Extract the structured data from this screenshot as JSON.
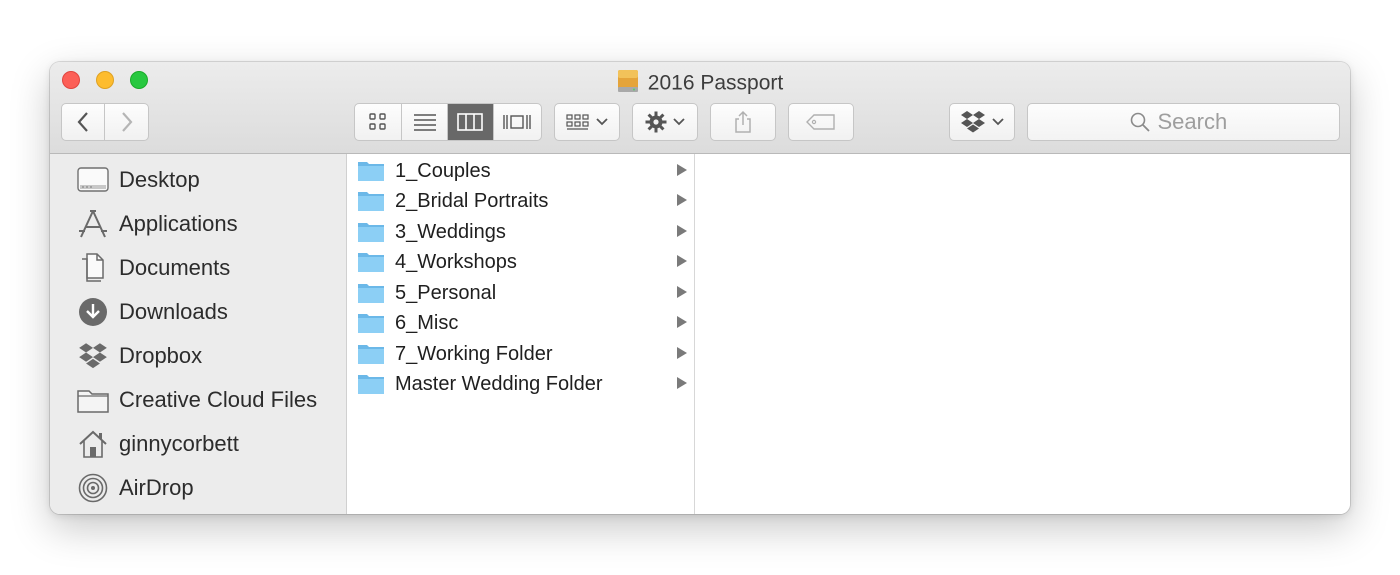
{
  "window": {
    "title": "2016 Passport"
  },
  "toolbar": {
    "back_icon": "chevron-left-icon",
    "forward_icon": "chevron-right-icon",
    "view_modes": [
      "icon-view-icon",
      "list-view-icon",
      "column-view-icon",
      "cover-flow-icon"
    ],
    "active_view": "column-view-icon",
    "arrange_icon": "arrange-icon",
    "action_icon": "gear-icon",
    "share_icon": "share-icon",
    "tag_icon": "tag-icon",
    "dropbox_icon": "dropbox-icon",
    "search": {
      "placeholder": "Search",
      "value": ""
    }
  },
  "sidebar": {
    "items": [
      {
        "label": "Desktop",
        "icon": "desktop-icon"
      },
      {
        "label": "Applications",
        "icon": "applications-icon"
      },
      {
        "label": "Documents",
        "icon": "documents-icon"
      },
      {
        "label": "Downloads",
        "icon": "downloads-icon"
      },
      {
        "label": "Dropbox",
        "icon": "dropbox-icon"
      },
      {
        "label": "Creative Cloud Files",
        "icon": "folder-icon"
      },
      {
        "label": "ginnycorbett",
        "icon": "home-icon"
      },
      {
        "label": "AirDrop",
        "icon": "airdrop-icon"
      }
    ]
  },
  "browser": {
    "column1": [
      {
        "name": "1_Couples"
      },
      {
        "name": "2_Bridal Portraits"
      },
      {
        "name": "3_Weddings"
      },
      {
        "name": "4_Workshops"
      },
      {
        "name": "5_Personal"
      },
      {
        "name": "6_Misc"
      },
      {
        "name": "7_Working Folder"
      },
      {
        "name": "Master Wedding Folder"
      }
    ]
  },
  "colors": {
    "close": "#fc5f57",
    "minimize": "#fdbc2e",
    "maximize": "#28c840",
    "folder": "#7cc6f0",
    "active_segment": "#686868"
  }
}
